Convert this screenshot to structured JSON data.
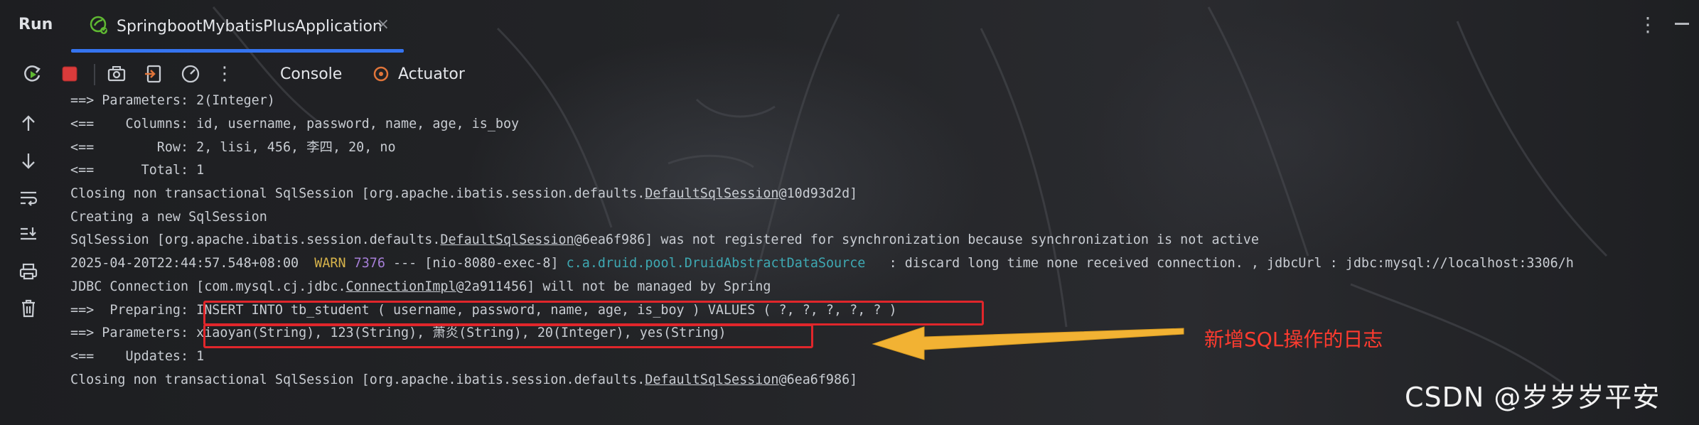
{
  "header": {
    "panel_title": "Run",
    "tab_label": "SpringbootMybatisPlusApplication",
    "tab_close": "×"
  },
  "toolbar": {
    "tabs": [
      "Console",
      "Actuator"
    ],
    "accent": "#3574f0",
    "icons": [
      "rerun-icon",
      "stop-icon",
      "camera-icon",
      "exit-icon",
      "gauge-icon",
      "more-icon"
    ]
  },
  "leftbar": {
    "icons": [
      "arrow-up-icon",
      "arrow-down-icon",
      "soft-wrap-icon",
      "scroll-to-end-icon",
      "print-icon",
      "trash-icon"
    ]
  },
  "console": {
    "lines": [
      "==> Parameters: 2(Integer)",
      "<==    Columns: id, username, password, name, age, is_boy",
      "<==        Row: 2, lisi, 456, 李四, 20, no",
      "<==      Total: 1",
      "Closing non transactional SqlSession [org.apache.ibatis.session.defaults.DefaultSqlSession@10d93d2d]",
      "Creating a new SqlSession",
      "SqlSession [org.apache.ibatis.session.defaults.DefaultSqlSession@6ea6f986] was not registered for synchronization because synchronization is not active",
      "JDBC Connection [com.mysql.cj.jdbc.ConnectionImpl@2a911456] will not be managed by Spring",
      "==>  Preparing: ",
      "==> Parameters: ",
      "<==    Updates: 1",
      "Closing non transactional SqlSession [org.apache.ibatis.session.defaults.DefaultSqlSession@6ea6f986]"
    ],
    "warn_line": {
      "timestamp": "2025-04-20T22:44:57.548+08:00",
      "level": "WARN",
      "pid": "7376",
      "sep": "---",
      "thread": "[nio-8080-exec-8]",
      "logger": "c.a.druid.pool.DruidAbstractDataSource",
      "message": ": discard long time none received connection. , jdbcUrl : jdbc:mysql://localhost:3306/h"
    },
    "preparing_sql": "INSERT INTO tb_student ( username, password, name, age, is_boy ) VALUES ( ?, ?, ?, ?, ? )",
    "parameters_values": "xiaoyan(String), 123(String), 萧炎(String), 20(Integer), yes(String)"
  },
  "annotation": {
    "text": "新增SQL操作的日志",
    "color": "#ff3b2f"
  },
  "watermark": "CSDN @岁岁岁平安"
}
